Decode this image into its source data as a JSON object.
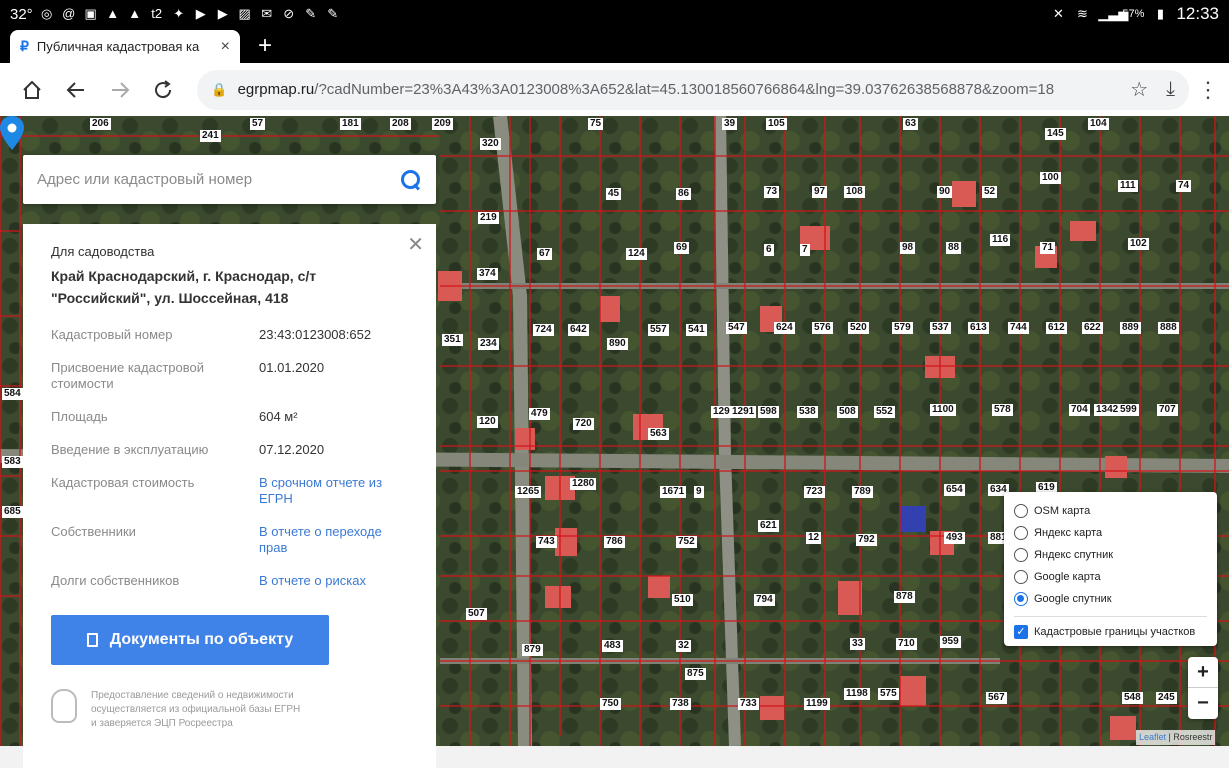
{
  "statusbar": {
    "temp": "32°",
    "battery": "57%",
    "time": "12:33",
    "left_icons": [
      "whatsapp-icon",
      "at-icon",
      "gallery-icon",
      "warning-icon",
      "warning-icon",
      "t2-icon",
      "sparkle-icon",
      "youtube-icon",
      "youtube-icon",
      "image-icon",
      "mail-icon",
      "compass-icon",
      "wrench-icon",
      "wrench-icon"
    ]
  },
  "tab": {
    "title": "Публичная кадастровая ка",
    "close": "×",
    "new_tab": "+"
  },
  "toolbar": {
    "url_host": "egrpmap.ru",
    "url_rest": "/?cadNumber=23%3A43%3A0123008%3A652&lat=45.130018560766864&lng=39.03762638568878&zoom=18"
  },
  "search": {
    "placeholder": "Адрес или кадастровый номер"
  },
  "card": {
    "category": "Для садоводства",
    "address_line1": "Край Краснодарский, г. Краснодар, с/т",
    "address_line2": "\"Российский\", ул. Шоссейная, 418",
    "rows": [
      {
        "key": "Кадастровый номер",
        "value": "23:43:0123008:652",
        "link": false
      },
      {
        "key": "Присвоение кадастровой стоимости",
        "value": "01.01.2020",
        "link": false
      },
      {
        "key": "Площадь",
        "value": "604 м²",
        "link": false
      },
      {
        "key": "Введение в эксплуатацию",
        "value": "07.12.2020",
        "link": false
      },
      {
        "key": "Кадастровая стоимость",
        "value": "В срочном отчете из ЕГРН",
        "link": true
      },
      {
        "key": "Собственники",
        "value": "В отчете о переходе прав",
        "link": true
      },
      {
        "key": "Долги собственников",
        "value": "В отчете о рисках",
        "link": true
      }
    ],
    "docs_button": "Документы по объекту",
    "footer_line1": "Предоставление сведений о недвижимости",
    "footer_line2": "осуществляется из официальной базы ЕГРН",
    "footer_line3": "и заверяется ЭЦП Росреестра"
  },
  "layers": {
    "options": [
      {
        "label": "OSM карта",
        "selected": false
      },
      {
        "label": "Яндекс карта",
        "selected": false
      },
      {
        "label": "Яндекс спутник",
        "selected": false
      },
      {
        "label": "Google карта",
        "selected": false
      },
      {
        "label": "Google спутник",
        "selected": true
      }
    ],
    "overlay": {
      "label": "Кадастровые границы участков",
      "checked": true
    }
  },
  "zoom": {
    "in": "+",
    "out": "−"
  },
  "attribution": {
    "leaflet": "Leaflet",
    "sep": " | ",
    "source": "Rosreestr"
  },
  "plots": [
    {
      "n": "206"
    },
    {
      "n": "241"
    },
    {
      "n": "57"
    },
    {
      "n": "181"
    },
    {
      "n": "208"
    },
    {
      "n": "209"
    },
    {
      "n": "320"
    },
    {
      "n": "75"
    },
    {
      "n": "105"
    },
    {
      "n": "39"
    },
    {
      "n": "63"
    },
    {
      "n": "145"
    },
    {
      "n": "104"
    },
    {
      "n": "45"
    },
    {
      "n": "86"
    },
    {
      "n": "73"
    },
    {
      "n": "97"
    },
    {
      "n": "108"
    },
    {
      "n": "90"
    },
    {
      "n": "52"
    },
    {
      "n": "100"
    },
    {
      "n": "111"
    },
    {
      "n": "74"
    },
    {
      "n": "219"
    },
    {
      "n": "67"
    },
    {
      "n": "124"
    },
    {
      "n": "69"
    },
    {
      "n": "6"
    },
    {
      "n": "7"
    },
    {
      "n": "98"
    },
    {
      "n": "88"
    },
    {
      "n": "116"
    },
    {
      "n": "71"
    },
    {
      "n": "102"
    },
    {
      "n": "374"
    },
    {
      "n": "234"
    },
    {
      "n": "724"
    },
    {
      "n": "642"
    },
    {
      "n": "890"
    },
    {
      "n": "557"
    },
    {
      "n": "541"
    },
    {
      "n": "547"
    },
    {
      "n": "624"
    },
    {
      "n": "576"
    },
    {
      "n": "520"
    },
    {
      "n": "579"
    },
    {
      "n": "537"
    },
    {
      "n": "613"
    },
    {
      "n": "744"
    },
    {
      "n": "612"
    },
    {
      "n": "622"
    },
    {
      "n": "889"
    },
    {
      "n": "888"
    },
    {
      "n": "120"
    },
    {
      "n": "479"
    },
    {
      "n": "720"
    },
    {
      "n": "563"
    },
    {
      "n": "1292"
    },
    {
      "n": "1291"
    },
    {
      "n": "598"
    },
    {
      "n": "538"
    },
    {
      "n": "508"
    },
    {
      "n": "552"
    },
    {
      "n": "1100"
    },
    {
      "n": "578"
    },
    {
      "n": "704"
    },
    {
      "n": "1342"
    },
    {
      "n": "599"
    },
    {
      "n": "707"
    },
    {
      "n": "1265"
    },
    {
      "n": "1280"
    },
    {
      "n": "1671"
    },
    {
      "n": "9"
    },
    {
      "n": "723"
    },
    {
      "n": "789"
    },
    {
      "n": "654"
    },
    {
      "n": "634"
    },
    {
      "n": "619"
    },
    {
      "n": "621"
    },
    {
      "n": "743"
    },
    {
      "n": "786"
    },
    {
      "n": "752"
    },
    {
      "n": "12"
    },
    {
      "n": "792"
    },
    {
      "n": "493"
    },
    {
      "n": "881"
    },
    {
      "n": "507"
    },
    {
      "n": "510"
    },
    {
      "n": "794"
    },
    {
      "n": "878"
    },
    {
      "n": "879"
    },
    {
      "n": "483"
    },
    {
      "n": "32"
    },
    {
      "n": "33"
    },
    {
      "n": "710"
    },
    {
      "n": "959"
    },
    {
      "n": "875"
    },
    {
      "n": "750"
    },
    {
      "n": "738"
    },
    {
      "n": "733"
    },
    {
      "n": "1199"
    },
    {
      "n": "1198"
    },
    {
      "n": "575"
    },
    {
      "n": "567"
    },
    {
      "n": "548"
    },
    {
      "n": "245"
    },
    {
      "n": "584"
    },
    {
      "n": "583"
    },
    {
      "n": "685"
    },
    {
      "n": "351"
    }
  ]
}
